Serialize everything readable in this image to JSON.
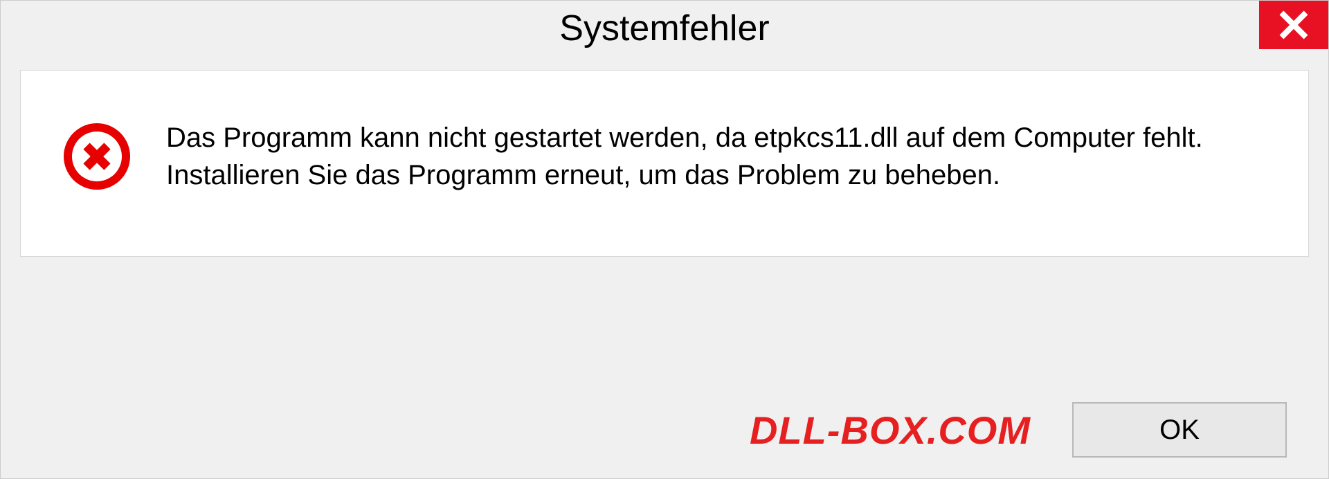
{
  "dialog": {
    "title": "Systemfehler",
    "message": "Das Programm kann nicht gestartet werden, da etpkcs11.dll auf dem Computer fehlt. Installieren Sie das Programm erneut, um das Problem zu beheben.",
    "ok_label": "OK"
  },
  "watermark": "DLL-BOX.COM",
  "colors": {
    "close_bg": "#e81123",
    "error_icon": "#e60000",
    "watermark": "#e62020"
  }
}
